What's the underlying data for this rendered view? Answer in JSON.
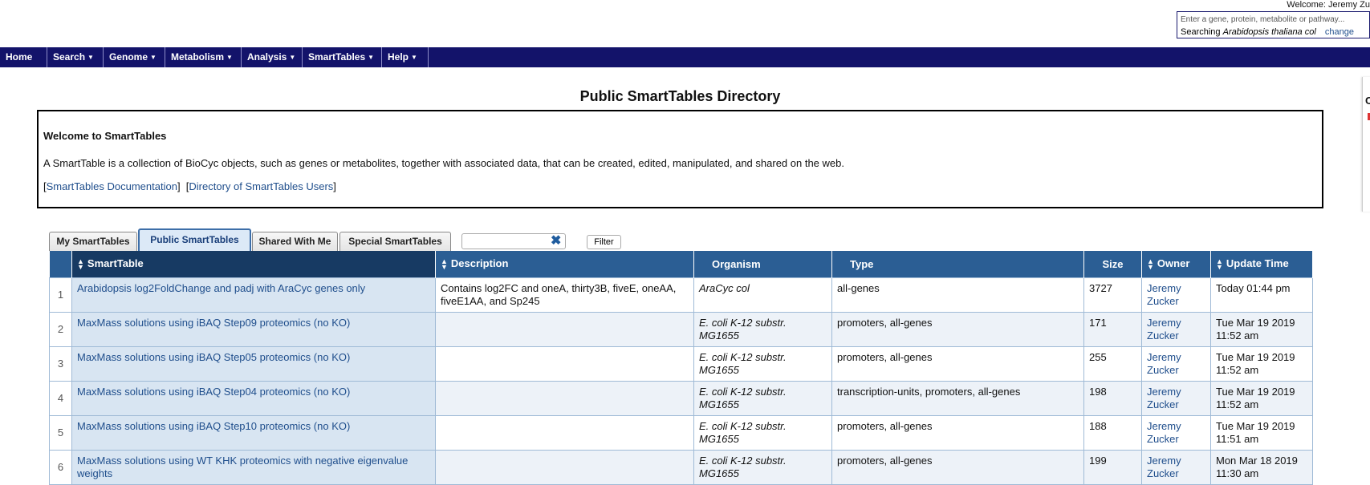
{
  "user": {
    "welcome": "Welcome: Jeremy Zu"
  },
  "search": {
    "placeholder": "Enter a gene, protein, metabolite or pathway...",
    "searching_prefix": "Searching",
    "organism": "Arabidopsis thaliana col",
    "change_label": "change"
  },
  "nav": {
    "items": [
      {
        "label": "Home",
        "has_menu": false
      },
      {
        "label": "Search",
        "has_menu": true
      },
      {
        "label": "Genome",
        "has_menu": true
      },
      {
        "label": "Metabolism",
        "has_menu": true
      },
      {
        "label": "Analysis",
        "has_menu": true
      },
      {
        "label": "SmartTables",
        "has_menu": true
      },
      {
        "label": "Help",
        "has_menu": true
      }
    ]
  },
  "page_title": "Public SmartTables Directory",
  "right_panel": {
    "letter": "C"
  },
  "intro": {
    "heading": "Welcome to SmartTables",
    "text": "A SmartTable is a collection of BioCyc objects, such as genes or metabolites, together with associated data, that can be created, edited, manipulated, and shared on the web.",
    "doc_link": "SmartTables Documentation",
    "users_link": "Directory of SmartTables Users"
  },
  "tabs": [
    {
      "label": "My SmartTables",
      "active": false
    },
    {
      "label": "Public SmartTables",
      "active": true
    },
    {
      "label": "Shared With Me",
      "active": false
    },
    {
      "label": "Special SmartTables",
      "active": false
    }
  ],
  "filter": {
    "value": "",
    "button_label": "Filter"
  },
  "table": {
    "columns": [
      "",
      "SmartTable",
      "Description",
      "Organism",
      "Type",
      "Size",
      "Owner",
      "Update Time"
    ],
    "rows": [
      {
        "index": "1",
        "name": "Arabidopsis log2FoldChange and padj with AraCyc genes only",
        "description": "Contains log2FC and oneA, thirty3B, fiveE, oneAA, fiveE1AA, and Sp245",
        "organism": "AraCyc col",
        "type": "all-genes",
        "size": "3727",
        "owner": "Jeremy Zucker",
        "updated": "Today 01:44 pm"
      },
      {
        "index": "2",
        "name": "MaxMass solutions using iBAQ Step09 proteomics (no KO)",
        "description": "",
        "organism": "E. coli K-12 substr. MG1655",
        "type": "promoters, all-genes",
        "size": "171",
        "owner": "Jeremy Zucker",
        "updated": "Tue Mar 19 2019 11:52 am"
      },
      {
        "index": "3",
        "name": "MaxMass solutions using iBAQ Step05 proteomics (no KO)",
        "description": "",
        "organism": "E. coli K-12 substr. MG1655",
        "type": "promoters, all-genes",
        "size": "255",
        "owner": "Jeremy Zucker",
        "updated": "Tue Mar 19 2019 11:52 am"
      },
      {
        "index": "4",
        "name": "MaxMass solutions using iBAQ Step04 proteomics (no KO)",
        "description": "",
        "organism": "E. coli K-12 substr. MG1655",
        "type": "transcription-units, promoters, all-genes",
        "size": "198",
        "owner": "Jeremy Zucker",
        "updated": "Tue Mar 19 2019 11:52 am"
      },
      {
        "index": "5",
        "name": "MaxMass solutions using iBAQ Step10 proteomics (no KO)",
        "description": "",
        "organism": "E. coli K-12 substr. MG1655",
        "type": "promoters, all-genes",
        "size": "188",
        "owner": "Jeremy Zucker",
        "updated": "Tue Mar 19 2019 11:51 am"
      },
      {
        "index": "6",
        "name": "MaxMass solutions using WT KHK proteomics with negative eigenvalue weights",
        "description": "",
        "organism": "E. coli K-12 substr. MG1655",
        "type": "promoters, all-genes",
        "size": "199",
        "owner": "Jeremy Zucker",
        "updated": "Mon Mar 18 2019 11:30 am"
      }
    ]
  },
  "colors": {
    "nav_bg": "#13136a",
    "header_bg": "#2b5e94",
    "link": "#1f4e8c"
  },
  "icons": {
    "clear_filter": "close-x-icon",
    "sort": "sort-arrows-icon",
    "menu_caret": "caret-down-icon"
  }
}
